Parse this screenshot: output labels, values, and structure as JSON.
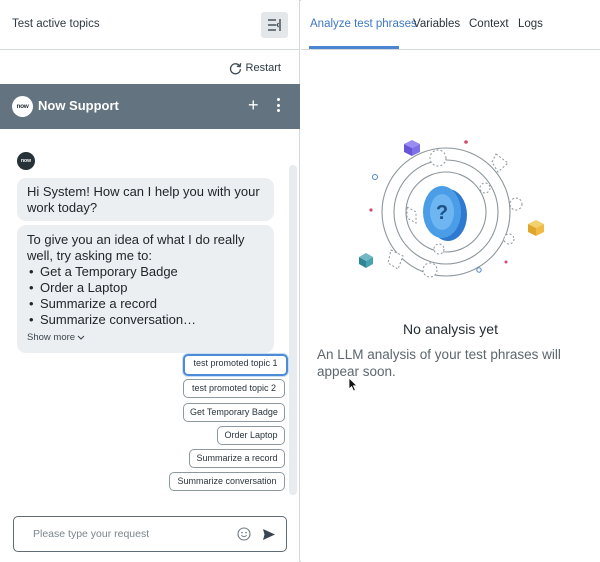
{
  "left": {
    "title": "Test active topics",
    "restart_label": "Restart"
  },
  "chat": {
    "logo_text": "now",
    "name": "Now Support",
    "greeting": "Hi System! How can I help you with your work today?",
    "intro": "To give you an idea of what I do really well, try asking me to:",
    "suggestions": [
      "Get a Temporary Badge",
      "Order a Laptop",
      "Summarize a record",
      "Summarize conversation…"
    ],
    "show_more": "Show more",
    "chips": [
      "test promoted topic 1",
      "test promoted topic 2",
      "Get Temporary Badge",
      "Order Laptop",
      "Summarize a record",
      "Summarize conversation"
    ],
    "input_placeholder": "Please type your request"
  },
  "right": {
    "tabs": [
      "Analyze test phrases",
      "Variables",
      "Context",
      "Logs"
    ],
    "selected_tab": "Analyze test phrases",
    "empty_title": "No analysis yet",
    "empty_desc": "An LLM analysis of your test phrases will appear soon."
  },
  "colors": {
    "accent": "#3e77c4",
    "chat_header": "#63737f",
    "bubble": "#eceff1",
    "chip_active_border": "#4c8bd6"
  },
  "icons": [
    "collapse-panel-icon",
    "restart-icon",
    "plus-icon",
    "more-icon",
    "emoji-icon",
    "send-icon",
    "question-icon"
  ]
}
